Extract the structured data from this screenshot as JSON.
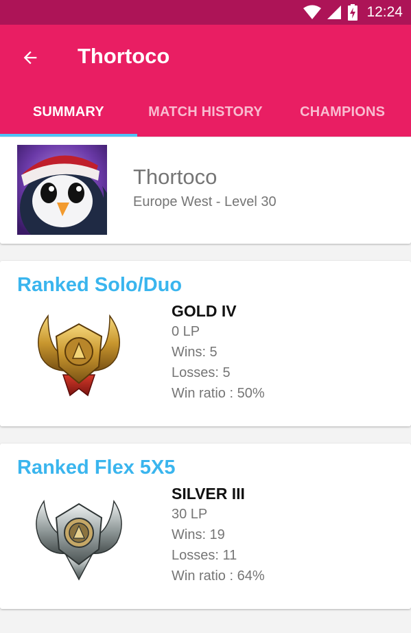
{
  "status_bar": {
    "time": "12:24",
    "icons": [
      "wifi-icon",
      "signal-icon",
      "battery-charging-icon"
    ]
  },
  "app_bar": {
    "title": "Thortoco",
    "back_icon": "arrow-back-icon"
  },
  "tabs": [
    {
      "label": "SUMMARY",
      "active": true
    },
    {
      "label": "MATCH HISTORY",
      "active": false
    },
    {
      "label": "CHAMPIONS",
      "active": false
    }
  ],
  "profile": {
    "name": "Thortoco",
    "subtitle": "Europe West - Level 30",
    "avatar_icon": "penguin-avatar"
  },
  "ranked": [
    {
      "queue": "Ranked Solo/Duo",
      "tier": "GOLD IV",
      "lp": "0 LP",
      "wins": "Wins: 5",
      "losses": "Losses: 5",
      "win_ratio": "Win ratio : 50%",
      "emblem": "gold-emblem-icon"
    },
    {
      "queue": "Ranked Flex 5X5",
      "tier": "SILVER III",
      "lp": "30 LP",
      "wins": "Wins: 19",
      "losses": "Losses: 11",
      "win_ratio": "Win ratio : 64%",
      "emblem": "silver-emblem-icon"
    }
  ],
  "colors": {
    "status_bar": "#ad1457",
    "primary": "#e91e63",
    "accent": "#4fc3f7",
    "rank_title": "#3ab5ee"
  }
}
